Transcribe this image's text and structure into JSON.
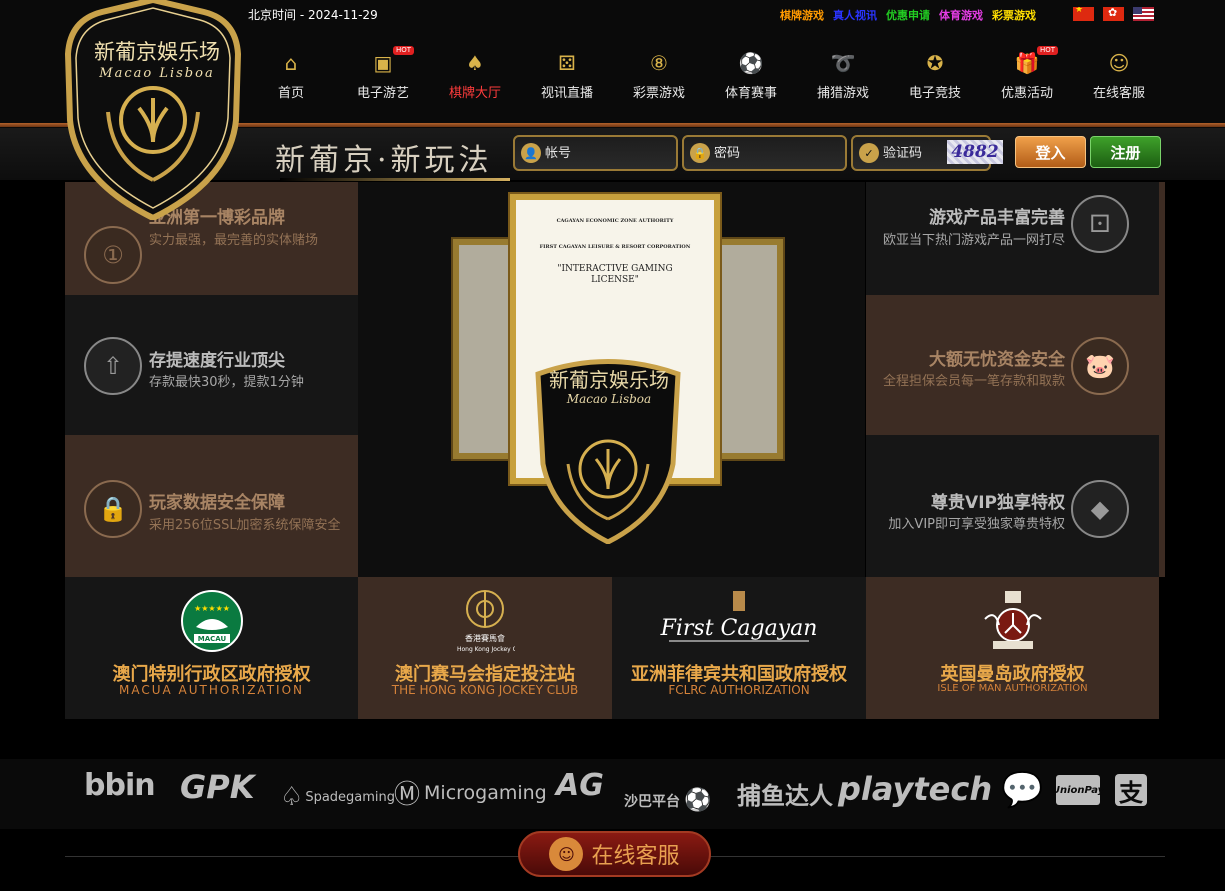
{
  "header": {
    "time_label": "北京时间 - 2024-11-29",
    "top_links": [
      {
        "label": "棋牌游戏",
        "color": "#ff9a00"
      },
      {
        "label": "真人视讯",
        "color": "#2a34ff"
      },
      {
        "label": "优惠申请",
        "color": "#22cc22"
      },
      {
        "label": "体育游戏",
        "color": "#e43ce4"
      },
      {
        "label": "彩票游戏",
        "color": "#ffde00"
      }
    ],
    "flags": [
      "cn-flag-icon",
      "hk-flag-icon",
      "us-flag-icon"
    ],
    "hot_badge": "HOT"
  },
  "logo": {
    "line1": "新葡京娛乐场",
    "line2": "Macao Lisboa"
  },
  "nav": [
    {
      "label": "首页",
      "icon": "home-icon",
      "glyph": "⌂",
      "hot": false,
      "active": false
    },
    {
      "label": "电子游艺",
      "icon": "slot-machine-icon",
      "glyph": "▣",
      "hot": true,
      "active": false
    },
    {
      "label": "棋牌大厅",
      "icon": "cards-icon",
      "glyph": "♠",
      "hot": false,
      "active": true
    },
    {
      "label": "视讯直播",
      "icon": "dice-icon",
      "glyph": "⚄",
      "hot": false,
      "active": false
    },
    {
      "label": "彩票游戏",
      "icon": "lottery-ball-icon",
      "glyph": "⑧",
      "hot": false,
      "active": false
    },
    {
      "label": "体育赛事",
      "icon": "soccer-ball-icon",
      "glyph": "⚽",
      "hot": false,
      "active": false
    },
    {
      "label": "捕猎游戏",
      "icon": "fish-icon",
      "glyph": "➰",
      "hot": false,
      "active": false
    },
    {
      "label": "电子竞技",
      "icon": "esports-ball-icon",
      "glyph": "✪",
      "hot": false,
      "active": false
    },
    {
      "label": "优惠活动",
      "icon": "gift-icon",
      "glyph": "🎁",
      "hot": true,
      "active": false
    },
    {
      "label": "在线客服",
      "icon": "headset-icon",
      "glyph": "☺",
      "hot": false,
      "active": false
    }
  ],
  "login": {
    "slogan": "新葡京·新玩法",
    "account_placeholder": "帐号",
    "password_placeholder": "密码",
    "captcha_placeholder": "验证码",
    "captcha_code": "4882",
    "login_label": "登入",
    "register_label": "注册"
  },
  "features": [
    {
      "title": "亚洲第一博彩品牌",
      "subtitle": "实力最强，最完善的实体赌场",
      "icon": "medal-icon",
      "glyph": "①"
    },
    {
      "title": "存提速度行业顶尖",
      "subtitle": "存款最快30秒，提款1分钟",
      "icon": "rocket-icon",
      "glyph": "⇧"
    },
    {
      "title": "玩家数据安全保障",
      "subtitle": "采用256位SSL加密系统保障安全",
      "icon": "lock-icon",
      "glyph": "🔒"
    },
    {
      "title": "游戏产品丰富完善",
      "subtitle": "欧亚当下热门游戏产品一网打尽",
      "icon": "dice-icon",
      "glyph": "⚀"
    },
    {
      "title": "大额无忧资金安全",
      "subtitle": "全程担保会员每一笔存款和取款",
      "icon": "piggy-bank-icon",
      "glyph": "🐷"
    },
    {
      "title": "尊贵VIP独享特权",
      "subtitle": "加入VIP即可享受独家尊贵特权",
      "icon": "diamond-icon",
      "glyph": "◆"
    }
  ],
  "certificate": {
    "authority": "CAGAYAN ECONOMIC ZONE AUTHORITY",
    "corporation": "FIRST CAGAYAN LEISURE & RESORT CORPORATION",
    "license_title": "\"INTERACTIVE GAMING LICENSE\""
  },
  "authorizations": [
    {
      "title": "澳门特别行政区政府授权",
      "english": "MACUA  AUTHORIZATION",
      "emblem": "macau-emblem-icon",
      "emblem_text": "MACAU"
    },
    {
      "title": "澳门赛马会指定投注站",
      "english": "THE HONG KONG JOCKEY CLUB",
      "emblem": "jockey-club-emblem-icon",
      "emblem_text": "香港賽馬會\nThe Hong Kong Jockey Club"
    },
    {
      "title": "亚洲菲律宾共和国政府授权",
      "english": "FCLRC AUTHORIZATION",
      "emblem": "first-cagayan-emblem-icon",
      "emblem_text": "First Cagayan"
    },
    {
      "title": "英国曼岛政府授权",
      "english": "ISLE OF MAN AUTHORIZATION",
      "emblem": "isle-of-man-emblem-icon",
      "emblem_text": ""
    }
  ],
  "partners": [
    "bbin",
    "GPK",
    "Spadegaming",
    "Microgaming",
    "AG",
    "沙巴平台",
    "捕鱼达人",
    "playtech",
    "wechat-icon",
    "UnionPay",
    "alipay-icon"
  ],
  "footer": {
    "service_label": "在线客服"
  }
}
